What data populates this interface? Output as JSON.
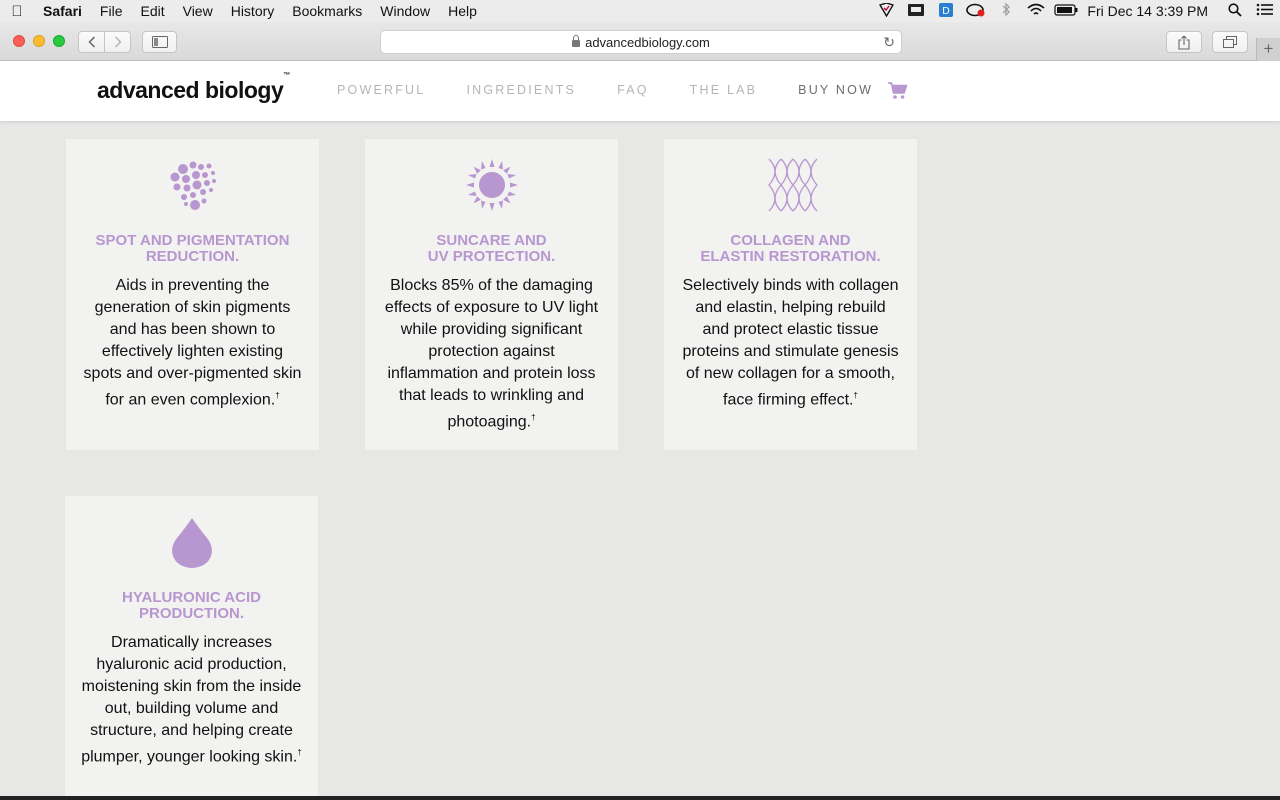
{
  "menubar": {
    "app_name": "Safari",
    "items": [
      "File",
      "Edit",
      "View",
      "History",
      "Bookmarks",
      "Window",
      "Help"
    ],
    "clock": "Fri Dec 14  3:39 PM"
  },
  "browser": {
    "url": "advancedbiology.com"
  },
  "site": {
    "logo": "advanced biology",
    "logo_tm": "™",
    "nav": [
      "POWERFUL",
      "INGREDIENTS",
      "FAQ",
      "THE LAB",
      "BUY NOW"
    ],
    "accent_color": "#b896cf"
  },
  "cards": [
    {
      "icon": "pigment-dots-icon",
      "title_line1": "SPOT AND PIGMENTATION",
      "title_line2": "REDUCTION.",
      "body": "Aids in preventing the generation of skin pigments and has been shown to effectively lighten existing spots and over-pigmented skin for an even complexion.",
      "mark": "†"
    },
    {
      "icon": "sun-icon",
      "title_line1": "SUNCARE AND",
      "title_line2": "UV PROTECTION.",
      "body": "Blocks 85% of the damaging effects of exposure to UV light while providing significant protection against inflammation and protein loss that leads to wrinkling and photoaging.",
      "mark": "†"
    },
    {
      "icon": "collagen-mesh-icon",
      "title_line1": "COLLAGEN AND",
      "title_line2": "ELASTIN RESTORATION.",
      "body": "Selectively binds with collagen and elastin, helping rebuild and protect elastic tissue proteins and stimulate genesis of new collagen for a smooth, face firming effect.",
      "mark": "†"
    },
    {
      "icon": "water-drop-icon",
      "title_line1": "HYALURONIC ACID",
      "title_line2": "PRODUCTION.",
      "body": "Dramatically increases hyaluronic acid production, moistening skin from the inside out, building volume and structure, and helping create plumper, younger looking skin.",
      "mark": "†"
    }
  ]
}
